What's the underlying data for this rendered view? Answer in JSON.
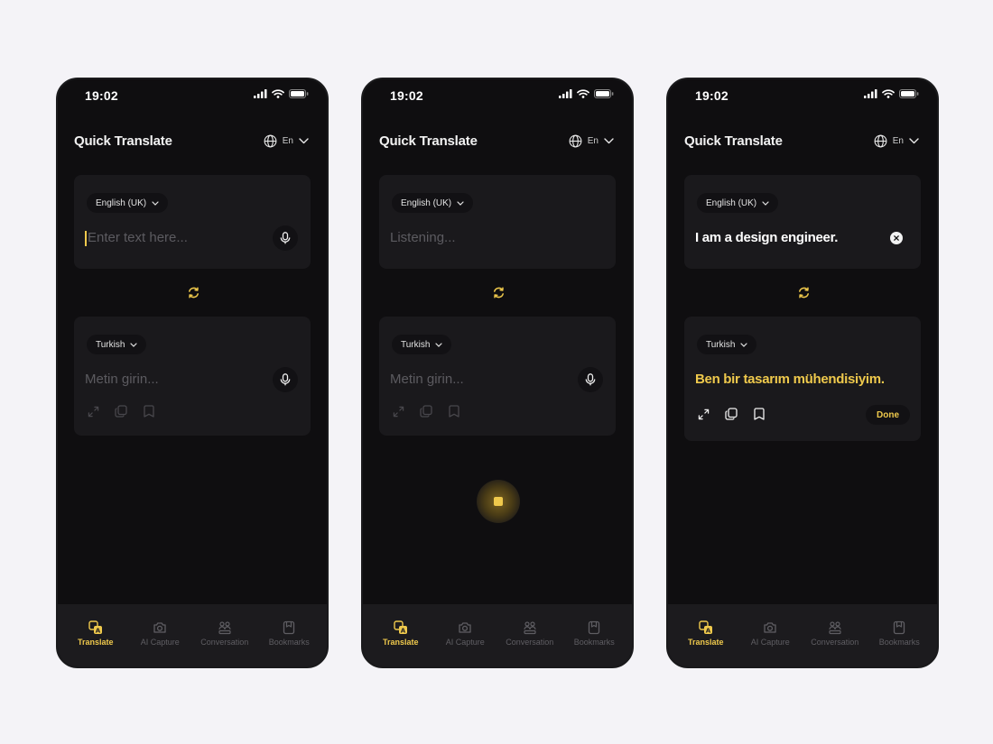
{
  "status": {
    "time": "19:02"
  },
  "app": {
    "title": "Quick Translate",
    "ui_language": "En"
  },
  "colors": {
    "accent": "#efc94c",
    "background": "#0f0e10",
    "card": "#1a191c"
  },
  "screens": [
    {
      "name": "empty",
      "source_lang": "English (UK)",
      "source_placeholder": "Enter text here...",
      "target_lang": "Turkish",
      "target_placeholder": "Metin girin..."
    },
    {
      "name": "listening",
      "source_lang": "English (UK)",
      "source_placeholder": "Listening...",
      "target_lang": "Turkish",
      "target_placeholder": "Metin girin..."
    },
    {
      "name": "translated",
      "source_lang": "English (UK)",
      "source_text": "I am a design engineer.",
      "target_lang": "Turkish",
      "target_text": "Ben bir tasarım mühendisiyim.",
      "done_label": "Done"
    }
  ],
  "tabs": [
    {
      "label": "Translate",
      "icon": "translate-icon",
      "active": true
    },
    {
      "label": "AI Capture",
      "icon": "camera-icon",
      "active": false
    },
    {
      "label": "Conversation",
      "icon": "conversation-icon",
      "active": false
    },
    {
      "label": "Bookmarks",
      "icon": "bookmark-icon",
      "active": false
    }
  ]
}
